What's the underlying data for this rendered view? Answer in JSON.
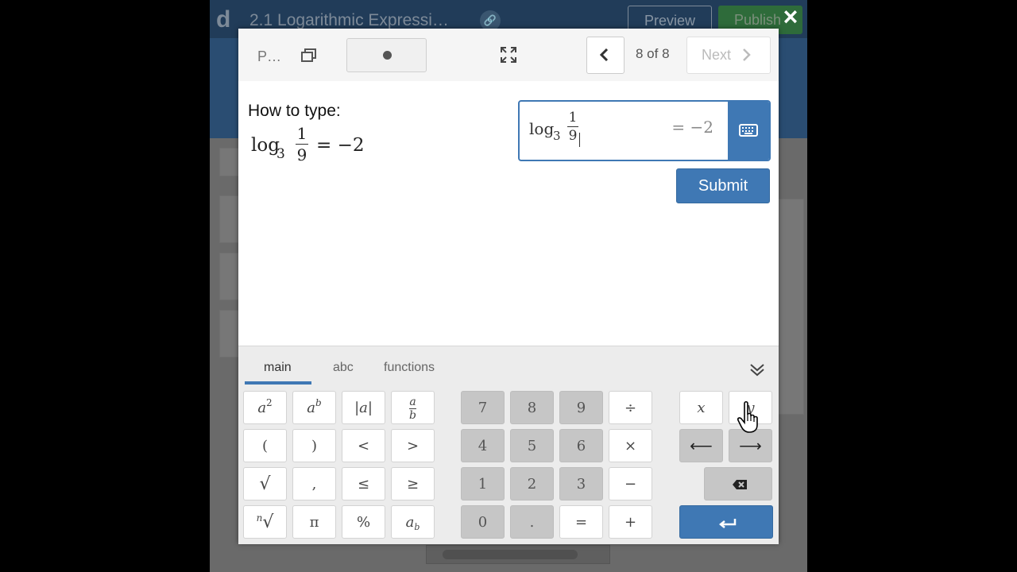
{
  "background": {
    "logo": "d",
    "title": "2.1 Logarithmic Expressi…",
    "preview_label": "Preview",
    "publish_label": "Publish"
  },
  "close_icon": "×",
  "toolbar": {
    "label": "P…",
    "page_count": "8 of 8",
    "next_label": "Next"
  },
  "prompt": {
    "how_to_label": "How to type:",
    "expression": {
      "fn": "log",
      "base": "3",
      "numerator": "1",
      "denominator": "9",
      "rhs": "= −2"
    }
  },
  "answer": {
    "fn": "log",
    "base": "3",
    "numerator": "1",
    "denominator": "9",
    "rhs": "= −2"
  },
  "submit_label": "Submit",
  "keypad": {
    "tabs": [
      "main",
      "abc",
      "functions"
    ],
    "active_tab": "main",
    "keys": {
      "sq": "a",
      "sq_exp": "2",
      "pow": "a",
      "pow_exp": "b",
      "abs": "|a|",
      "frac_num": "a",
      "frac_den": "b",
      "lparen": "(",
      "rparen": ")",
      "lt": "<",
      "gt": ">",
      "sqrt": "√",
      "comma": ",",
      "le": "≤",
      "ge": "≥",
      "nroot_n": "n",
      "nroot": "√",
      "pi": "π",
      "percent": "%",
      "sub_base": "a",
      "sub_idx": "b",
      "d7": "7",
      "d8": "8",
      "d9": "9",
      "div": "÷",
      "d4": "4",
      "d5": "5",
      "d6": "6",
      "mul": "×",
      "d1": "1",
      "d2": "2",
      "d3": "3",
      "minus": "−",
      "d0": "0",
      "dot": ".",
      "eq": "=",
      "plus": "+",
      "x": "x",
      "y": "y",
      "left": "⟵",
      "right": "⟶"
    }
  },
  "colors": {
    "accent": "#3f78b4",
    "header_bg": "#213c59"
  }
}
